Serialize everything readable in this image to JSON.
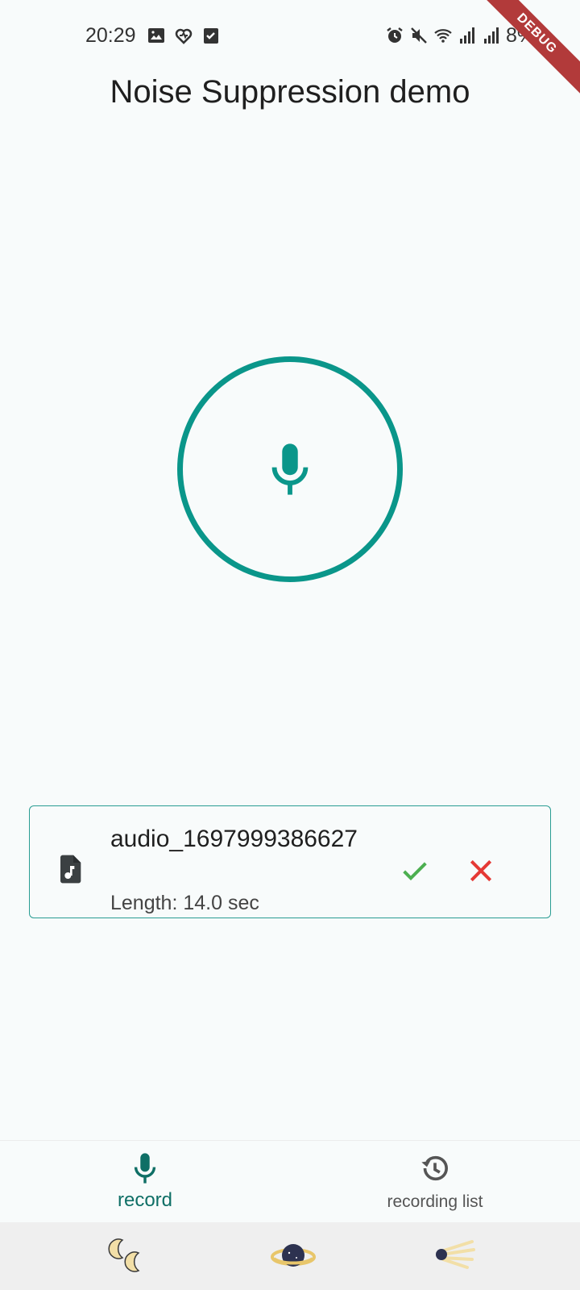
{
  "status_bar": {
    "time": "20:29",
    "battery": "8%",
    "left_icons": [
      "image-icon",
      "health-icon",
      "checkbox-icon"
    ],
    "right_icons": [
      "alarm-icon",
      "mute-icon",
      "wifi-icon",
      "signal-icon",
      "signal-icon",
      "download-icon"
    ]
  },
  "debug_banner": "DEBUG",
  "app": {
    "title": "Noise Suppression demo",
    "accent_color": "#0a968a"
  },
  "record_button": {
    "icon": "mic-icon"
  },
  "recording": {
    "file_name": "audio_1697999386627",
    "length_text": "Length: 14.0 sec",
    "confirm_color": "#4caf50",
    "discard_color": "#e53935"
  },
  "bottom_nav": {
    "items": [
      {
        "label": "record",
        "icon": "mic-icon",
        "selected": true
      },
      {
        "label": "recording list",
        "icon": "history-icon",
        "selected": false
      }
    ]
  },
  "system_nav": {
    "buttons": [
      "moons-icon",
      "planet-icon",
      "comet-icon"
    ]
  }
}
